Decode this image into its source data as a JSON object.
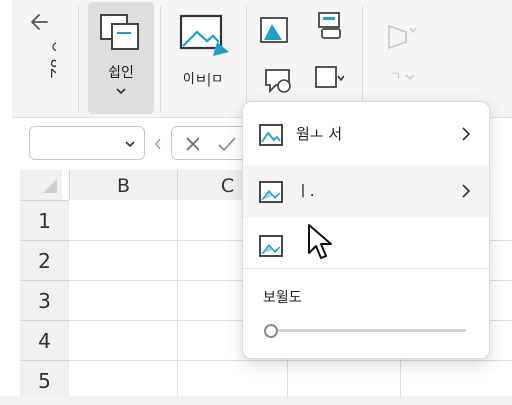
{
  "ribbon": {
    "vertical_text": "ㅇ 8Z",
    "insert_label": "쉽인",
    "image_label": "이ㅂ|ㅁ"
  },
  "grid": {
    "columns": [
      "B",
      "C"
    ],
    "rows": [
      "1",
      "2",
      "3",
      "4",
      "5"
    ]
  },
  "menu": {
    "items": [
      {
        "label": "웜ㅗ 서",
        "has_submenu": true
      },
      {
        "label": "ㅣ.",
        "has_submenu": true,
        "highlighted": true
      },
      {
        "label": "",
        "has_submenu": false
      }
    ],
    "slider_label": "보윌도",
    "slider_value": 0
  },
  "colors": {
    "accent": "#1fa0c4",
    "ribbon_bg": "#f5f5f5",
    "pressed_bg": "#dedede"
  },
  "icons": [
    "back-arrow-icon",
    "insert-icon",
    "image-icon",
    "shape-icon",
    "form-icon",
    "comment-icon",
    "cell-icon",
    "chevron-down-icon",
    "close-icon",
    "check-icon",
    "chevron-right-icon",
    "picture-icon",
    "cursor-icon"
  ]
}
